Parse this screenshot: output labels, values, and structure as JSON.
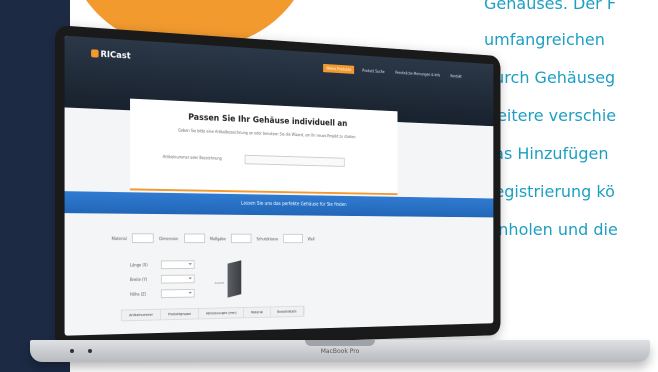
{
  "colors": {
    "navy": "#1c2a44",
    "orange": "#f29a2e",
    "blue_text": "#1d9fc4",
    "band_blue": "#2f7bd1"
  },
  "side_text": {
    "lines": [
      "Gehäuses. Der F",
      "umfangreichen",
      "durch Gehäuseg",
      "weitere verschie",
      "das Hinzufügen",
      "Registrierung kö",
      "einholen und die"
    ]
  },
  "laptop": {
    "brand": "MacBook Pro"
  },
  "site": {
    "logo": "RICast",
    "nav": [
      "Meine Produkte",
      "Produkt Suche",
      "Persönliche Meinungen & Info",
      "Kontakt"
    ],
    "hero_title": "Passen Sie Ihr Gehäuse individuell an",
    "hero_subtitle": "Geben Sie bitte eine Artikelbezeichnung an oder benutzen Sie die Wizard, um Ihr neues Projekt zu starten.",
    "field_label": "Artikelnummer oder Bezeichnung",
    "band_title": "Lassen Sie uns das perfekte Gehäuse für Sie finden",
    "filters": [
      "Material",
      "Dimension",
      "Maßgabe",
      "Schutzklasse",
      "Wall"
    ],
    "selects": [
      "Länge (X)",
      "Breite (Y)",
      "Höhe (Z)"
    ],
    "product_caption": "Ansicht",
    "table_headers": [
      "Artikelnummer",
      "Produktgruppe",
      "Abmessungen (mm)",
      "Material",
      "Bestelldetails"
    ]
  }
}
